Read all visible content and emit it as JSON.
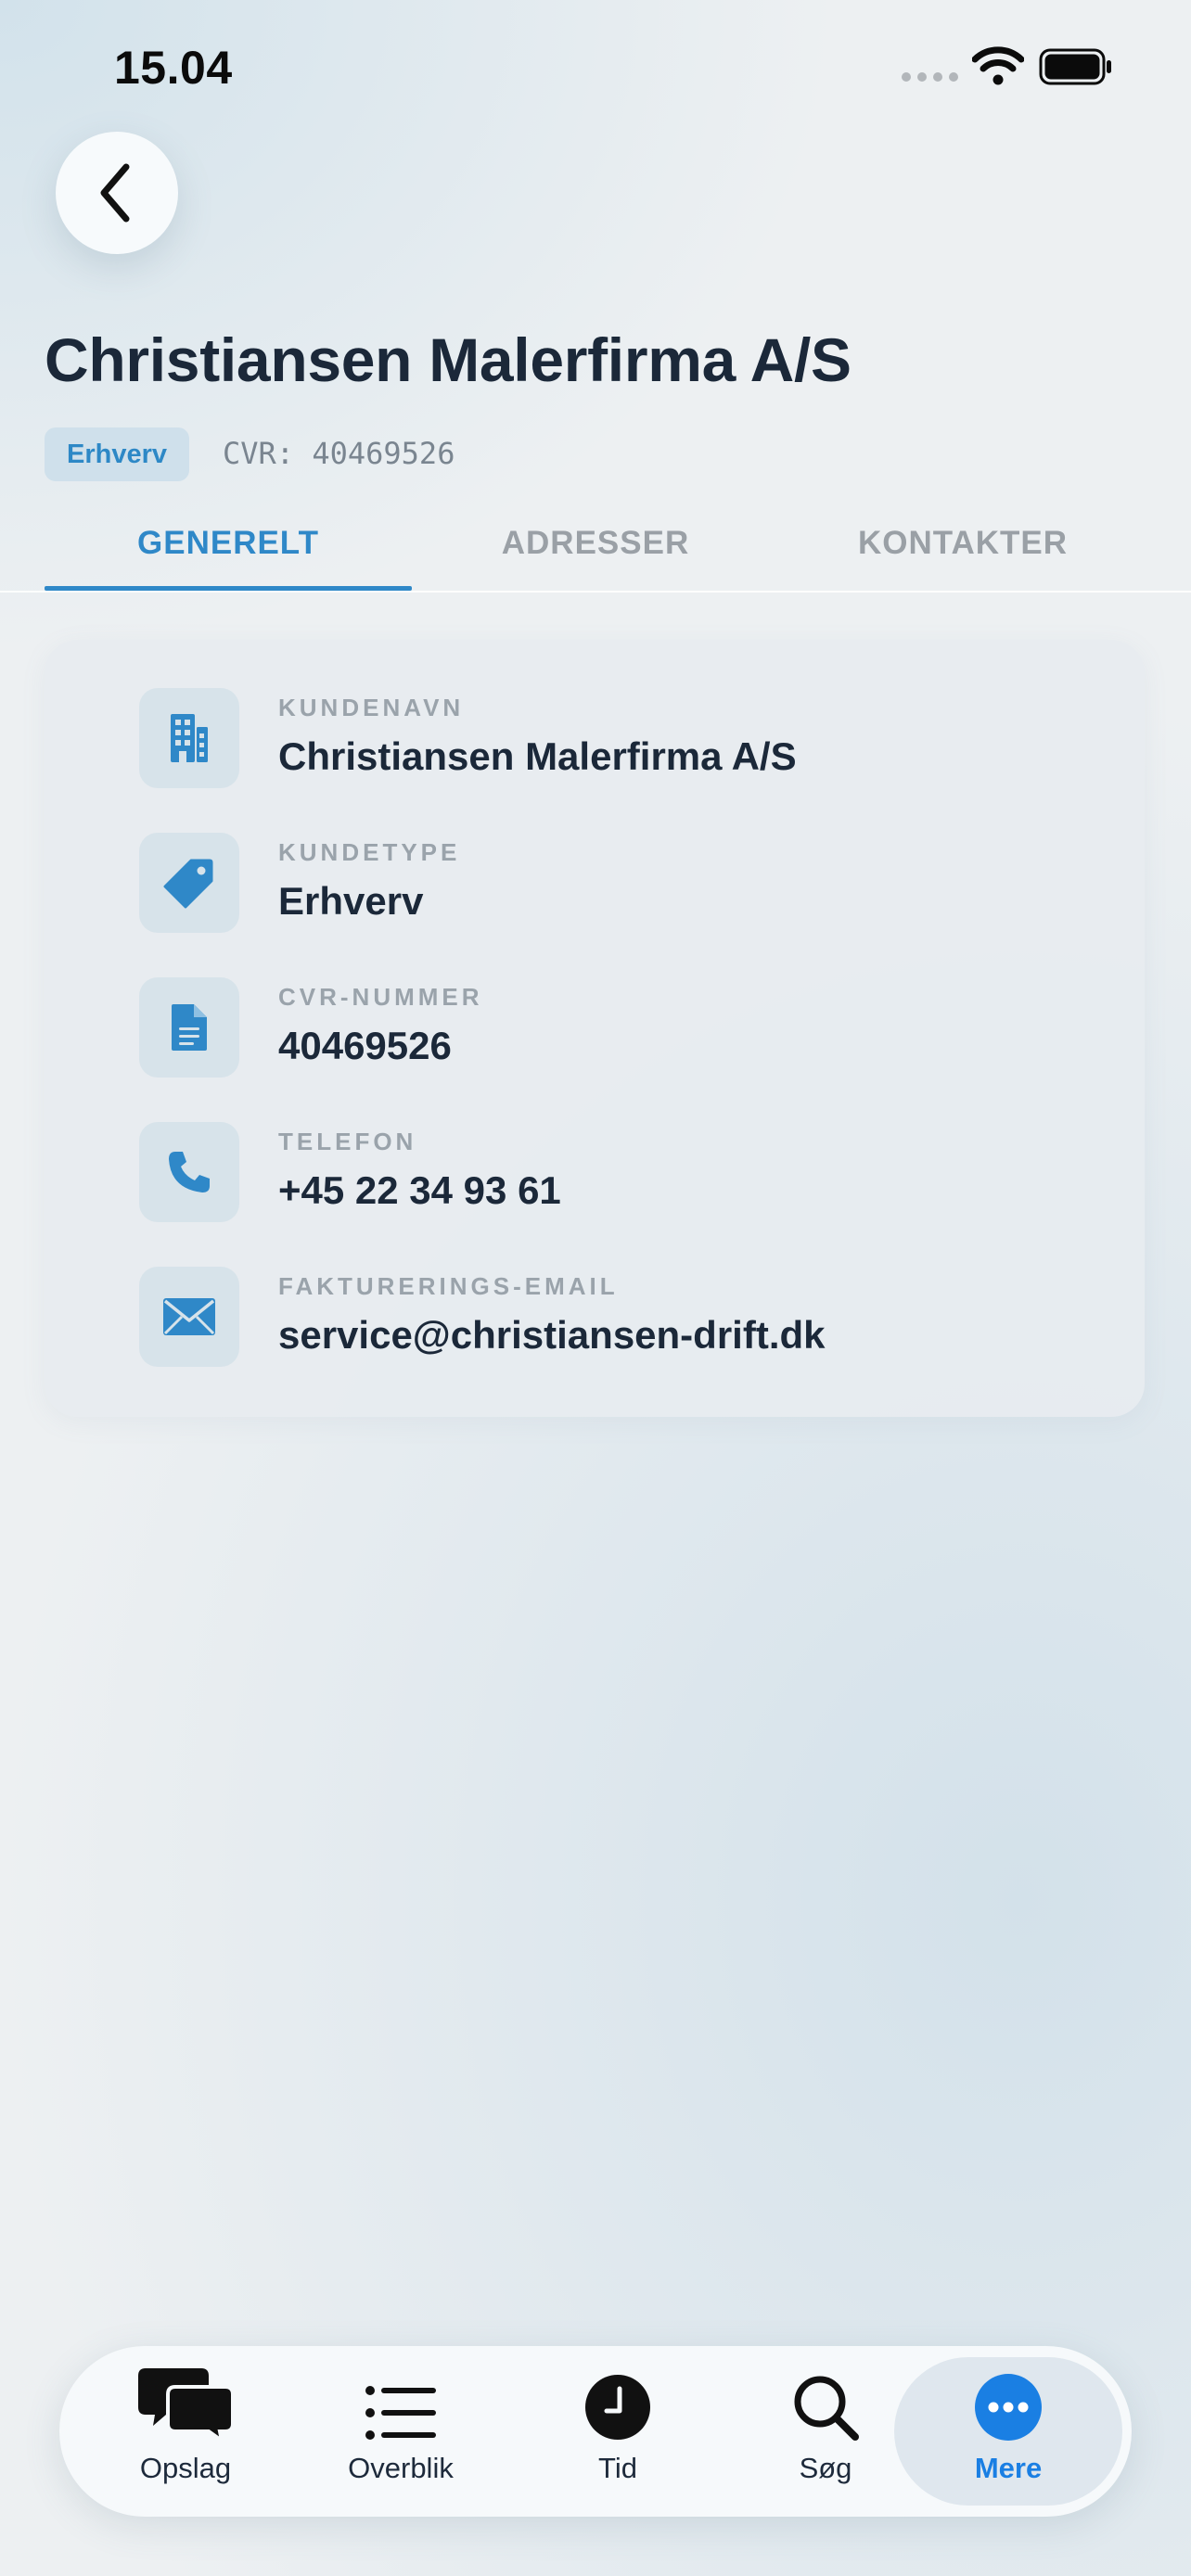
{
  "status_bar": {
    "time": "15.04"
  },
  "header": {
    "title": "Christiansen Malerfirma A/S",
    "badge": "Erhverv",
    "cvr_text": "CVR: 40469526"
  },
  "tabs": [
    {
      "label": "GENERELT",
      "active": true
    },
    {
      "label": "ADRESSER",
      "active": false
    },
    {
      "label": "KONTAKTER",
      "active": false
    }
  ],
  "info": [
    {
      "label": "KUNDENAVN",
      "value": "Christiansen Malerfirma A/S",
      "icon": "building-icon"
    },
    {
      "label": "KUNDETYPE",
      "value": "Erhverv",
      "icon": "tag-icon"
    },
    {
      "label": "CVR-NUMMER",
      "value": "40469526",
      "icon": "document-icon"
    },
    {
      "label": "TELEFON",
      "value": "+45 22 34 93 61",
      "icon": "phone-icon"
    },
    {
      "label": "FAKTURERINGS-EMAIL",
      "value": "service@christiansen-drift.dk",
      "icon": "mail-icon"
    }
  ],
  "tabbar": [
    {
      "label": "Opslag",
      "icon": "chat-bubbles-icon"
    },
    {
      "label": "Overblik",
      "icon": "list-icon"
    },
    {
      "label": "Tid",
      "icon": "clock-icon"
    },
    {
      "label": "Søg",
      "icon": "search-icon"
    },
    {
      "label": "Mere",
      "icon": "more-icon",
      "active": true
    }
  ],
  "colors": {
    "accent": "#2f88c8",
    "active_tab": "#1a7fe3",
    "text": "#1b2839"
  }
}
